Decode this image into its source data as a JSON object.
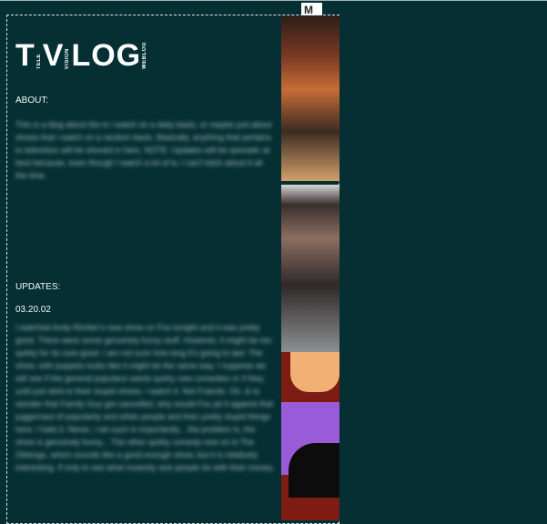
{
  "brand": {
    "logo_t": "T",
    "logo_tele": "TELE",
    "logo_v": "V",
    "logo_vision": "VISION",
    "logo_log": "LOG",
    "logo_weblog": "WEBLOG",
    "mtv_badge": "M"
  },
  "about": {
    "heading": "ABOUT:",
    "body": "This is a blog about the tv i watch on a daily basis, or maybe just about shows that i watch on a random basis. Basically, anything that pertains to television will be shoved in here. NOTE: Updates will be sporadic at best because, even though I watch a lot of tv, I can't bitch about it all the time."
  },
  "updates": {
    "heading": "UPDATES:",
    "date": "03.20.02",
    "body": "I watched Andy Richter's new show on Fox tonight and it was pretty good. There were some genuinely funny stuff. However, it might be too quirky for its core good. I am not sure how long it's going to last. The show, with puppets looks like it might be the same way. I suppose we will see if the general populace wants quirky new comedies or if they until just stick to their stupid shows. I watch it. Not Friends. Oh. & to wonder that Family Guy got cancelled, why would Fox pit it against that juggernaut of popularity and white people and then pretty stupid things here. I hate it. Never, i set such in importantly... the problem is, the show is genuinely funny... The other quirky comedy now on is The Oblongs, which sounds like a good enough show, but it is relatively interesting. If only to see what insanely sick people do with their money."
  }
}
